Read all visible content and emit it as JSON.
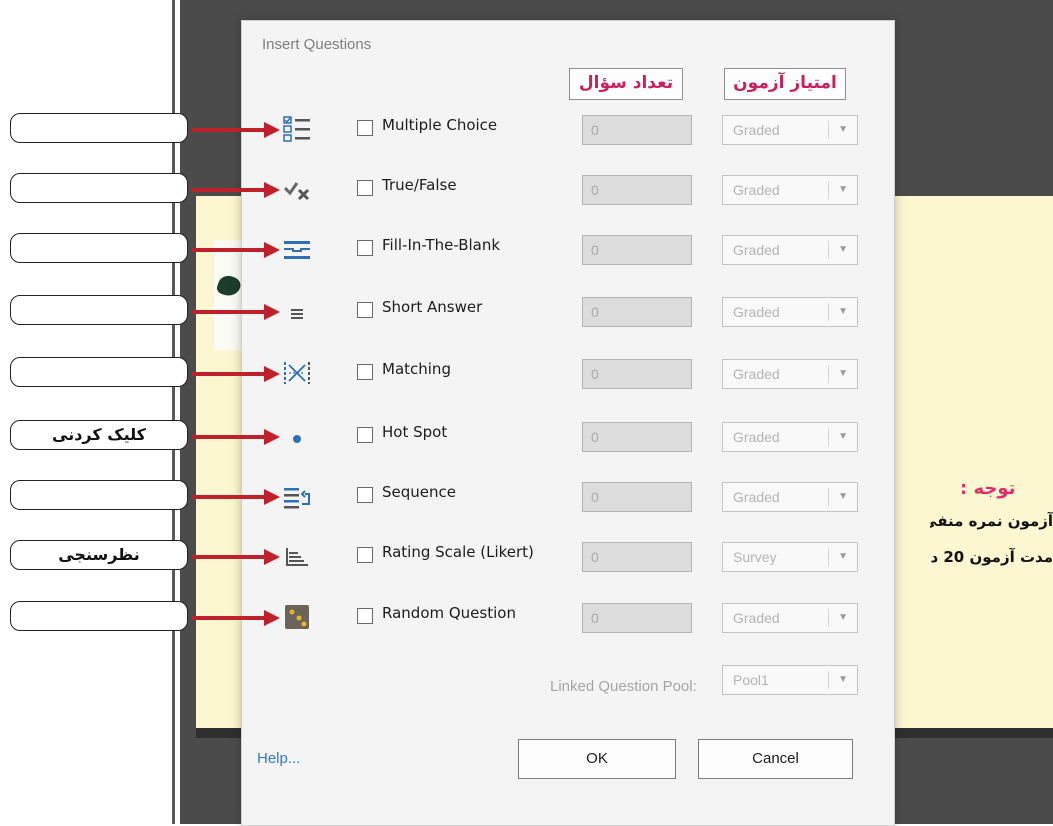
{
  "dialog": {
    "title": "Insert Questions",
    "headers": {
      "count": "تعداد سؤال",
      "score": "امتیاز آزمون"
    },
    "rows": [
      {
        "icon": "multiple-choice-icon",
        "label": "Multiple Choice",
        "count": "0",
        "mode": "Graded",
        "callout": ""
      },
      {
        "icon": "true-false-icon",
        "label": "True/False",
        "count": "0",
        "mode": "Graded",
        "callout": ""
      },
      {
        "icon": "fill-in-blank-icon",
        "label": "Fill-In-The-Blank",
        "count": "0",
        "mode": "Graded",
        "callout": ""
      },
      {
        "icon": "short-answer-icon",
        "label": "Short Answer",
        "count": "0",
        "mode": "Graded",
        "callout": ""
      },
      {
        "icon": "matching-icon",
        "label": "Matching",
        "count": "0",
        "mode": "Graded",
        "callout": ""
      },
      {
        "icon": "hot-spot-icon",
        "label": "Hot Spot",
        "count": "0",
        "mode": "Graded",
        "callout": "کلیک کردنی"
      },
      {
        "icon": "sequence-icon",
        "label": "Sequence",
        "count": "0",
        "mode": "Graded",
        "callout": ""
      },
      {
        "icon": "rating-scale-icon",
        "label": "Rating Scale (Likert)",
        "count": "0",
        "mode": "Survey",
        "callout": "نظرسنجی"
      },
      {
        "icon": "random-question-icon",
        "label": "Random Question",
        "count": "0",
        "mode": "Graded",
        "callout": ""
      }
    ],
    "pool": {
      "label": "Linked Question Pool:",
      "value": "Pool1"
    },
    "help": "Help...",
    "ok": "OK",
    "cancel": "Cancel"
  },
  "slide": {
    "note_title": "توجه :",
    "line1": "آزمون نمره منفی",
    "line2": "مدت آزمون 20 د"
  },
  "colors": {
    "accent": "#cc1f5c",
    "arrow": "#c0202a",
    "icon": "#2d6fb8",
    "link": "#2d7bd2"
  }
}
